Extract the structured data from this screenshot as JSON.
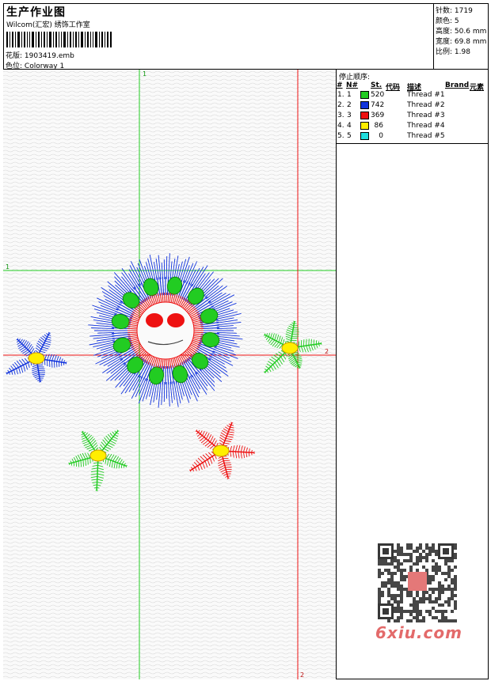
{
  "header": {
    "title": "生产作业图",
    "company": "Wilcom(汇宏) 绣饰工作室",
    "file_label": "花版:",
    "file_name": "1903419.emb",
    "colorway_label": "色位:",
    "colorway_name": "Colorway 1"
  },
  "specs": [
    {
      "label": "针数:",
      "value": "1719"
    },
    {
      "label": "颜色:",
      "value": "5"
    },
    {
      "label": "高度:",
      "value": "50.6 mm"
    },
    {
      "label": "宽度:",
      "value": "69.8 mm"
    },
    {
      "label": "比例:",
      "value": "1.98"
    }
  ],
  "stop_sequence": {
    "title": "停止顺序:",
    "headers": [
      "#",
      "N#",
      "St.",
      "代码",
      "描述",
      "Brand",
      "元素"
    ],
    "rows": [
      {
        "index": "1.",
        "needle": "1",
        "color": "#22cc22",
        "stitches": "520",
        "description": "Thread #1"
      },
      {
        "index": "2.",
        "needle": "2",
        "color": "#1133dd",
        "stitches": "742",
        "description": "Thread #2"
      },
      {
        "index": "3.",
        "needle": "3",
        "color": "#ee1111",
        "stitches": "369",
        "description": "Thread #3"
      },
      {
        "index": "4.",
        "needle": "4",
        "color": "#ffee00",
        "stitches": "86",
        "description": "Thread #4"
      },
      {
        "index": "5.",
        "needle": "5",
        "color": "#22dddd",
        "stitches": "0",
        "description": "Thread #5"
      }
    ]
  },
  "guides": {
    "top_label": "1",
    "left_label": "1",
    "right_label": "2",
    "bottom_label": "2"
  },
  "watermark": "6xiu.com"
}
